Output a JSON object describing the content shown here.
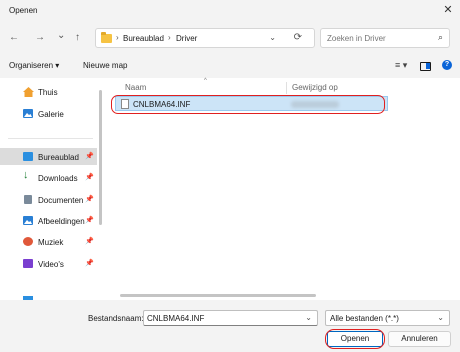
{
  "window": {
    "title": "Openen",
    "close_glyph": "✕"
  },
  "nav": {
    "back": "←",
    "forward": "→",
    "recent": "⌄",
    "up": "↑",
    "breadcrumb": [
      "Bureaublad",
      "Driver"
    ],
    "separator": "›",
    "refresh": "⟳",
    "search_placeholder": "Zoeken in Driver",
    "search_icon": "⌕"
  },
  "toolbar": {
    "organize": "Organiseren ▾",
    "new_folder": "Nieuwe map",
    "view_icon": "≡ ▾"
  },
  "sidebar": {
    "items": [
      {
        "label": "Thuis",
        "icon": "home-icon",
        "color": "#f0a030",
        "pinned": false
      },
      {
        "label": "Galerie",
        "icon": "gallery-icon",
        "color": "#2a7fd4",
        "pinned": false
      },
      {
        "label": "Bureaublad",
        "icon": "desktop-icon",
        "color": "#2a8fe0",
        "pinned": true
      },
      {
        "label": "Downloads",
        "icon": "download-icon",
        "color": "#1e7e34",
        "pinned": true
      },
      {
        "label": "Documenten",
        "icon": "documents-icon",
        "color": "#7a8a9a",
        "pinned": true
      },
      {
        "label": "Afbeeldingen",
        "icon": "pictures-icon",
        "color": "#2a7fd4",
        "pinned": true
      },
      {
        "label": "Muziek",
        "icon": "music-icon",
        "color": "#e0583a",
        "pinned": true
      },
      {
        "label": "Video's",
        "icon": "video-icon",
        "color": "#7a3fd0",
        "pinned": true
      }
    ]
  },
  "list": {
    "columns": {
      "name": "Naam",
      "modified": "Gewijzigd op"
    },
    "files": [
      {
        "name": "CNLBMA64.INF"
      }
    ]
  },
  "footer": {
    "filename_label": "Bestandsnaam:",
    "filename_value": "CNLBMA64.INF",
    "filter_value": "Alle bestanden (*.*)",
    "open_label": "Openen",
    "cancel_label": "Annuleren"
  },
  "colors": {
    "accent": "#0067c0",
    "selection": "#cce4f7",
    "annotation": "#e02020"
  }
}
